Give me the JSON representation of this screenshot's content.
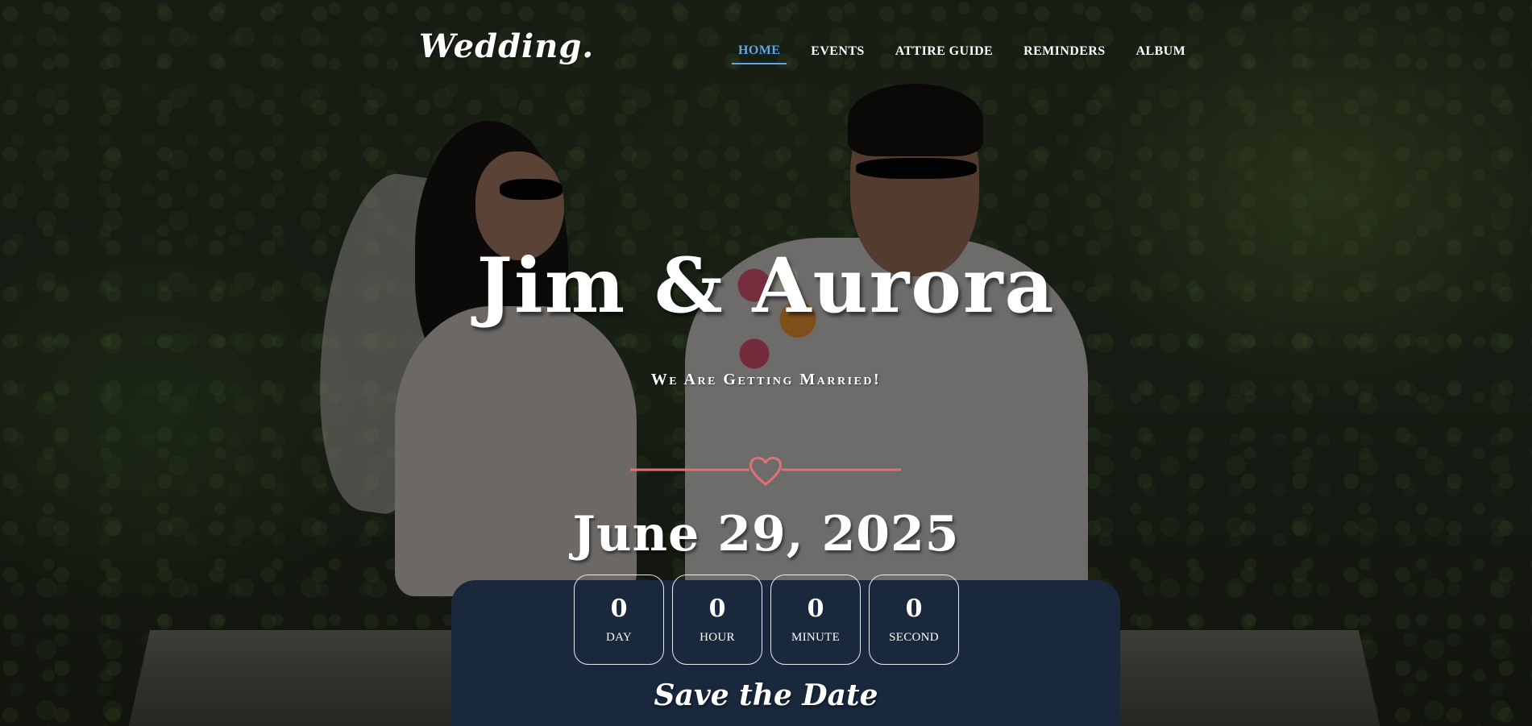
{
  "brand": {
    "name": "Wedding."
  },
  "nav": {
    "items": [
      {
        "label": "HOME",
        "active": true
      },
      {
        "label": "EVENTS",
        "active": false
      },
      {
        "label": "ATTIRE GUIDE",
        "active": false
      },
      {
        "label": "REMINDERS",
        "active": false
      },
      {
        "label": "ALBUM",
        "active": false
      }
    ]
  },
  "hero": {
    "couple_names": "Jim & Aurora",
    "tagline": "We Are Getting Married!",
    "date": "June 29, 2025",
    "save_the_date": "Save the Date",
    "divider_icon": "heart-icon"
  },
  "countdown": [
    {
      "value": "0",
      "label": "DAY"
    },
    {
      "value": "0",
      "label": "HOUR"
    },
    {
      "value": "0",
      "label": "MINUTE"
    },
    {
      "value": "0",
      "label": "SECOND"
    }
  ],
  "colors": {
    "accent_nav": "#5aa7e4",
    "divider": "#e07077",
    "text": "#ffffff"
  }
}
